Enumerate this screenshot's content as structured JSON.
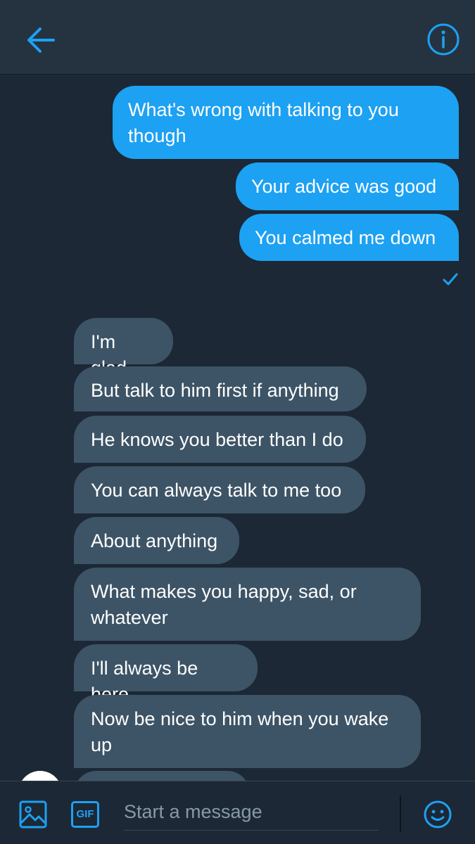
{
  "header": {
    "back_icon": "arrow-left-icon",
    "info_icon": "info-icon"
  },
  "colors": {
    "accent": "#1da1f2",
    "header_bg": "#253341",
    "background": "#1c2836",
    "received_bubble": "#3d5466"
  },
  "sent_messages": [
    "What's wrong with talking to you\nthough",
    "Your advice was good",
    "You calmed me down"
  ],
  "received_messages": [
    "I'm glad",
    "But talk to him first if anything",
    "He knows you better than I do",
    "You can always talk to me too",
    "About anything",
    "What makes you happy, sad, or\nwhatever",
    "I'll always be here",
    "Now be nice to him when you wake\nup"
  ],
  "status_icon": "checkmark-icon",
  "composer": {
    "placeholder": "Start a message",
    "gif_label": "GIF",
    "media_icon": "image-icon",
    "emoji_icon": "emoji-icon"
  }
}
